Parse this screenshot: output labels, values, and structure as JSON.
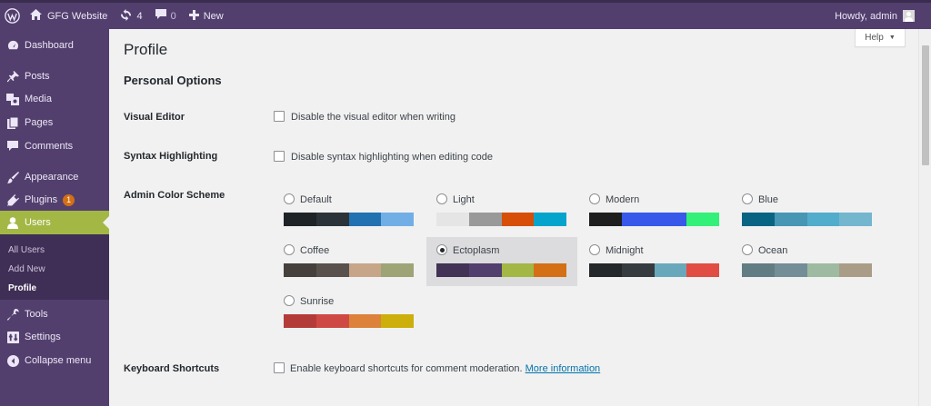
{
  "adminbar": {
    "site_name": "GFG Website",
    "updates_count": "4",
    "comments_count": "0",
    "new_label": "New",
    "howdy": "Howdy, admin"
  },
  "sidebar": {
    "items": [
      {
        "label": "Dashboard",
        "icon": "dashboard-icon"
      },
      {
        "label": "Posts",
        "icon": "pin-icon"
      },
      {
        "label": "Media",
        "icon": "media-icon"
      },
      {
        "label": "Pages",
        "icon": "pages-icon"
      },
      {
        "label": "Comments",
        "icon": "comments-icon"
      },
      {
        "label": "Appearance",
        "icon": "brush-icon"
      },
      {
        "label": "Plugins",
        "icon": "plugin-icon",
        "badge": "1"
      },
      {
        "label": "Users",
        "icon": "users-icon",
        "current": true
      },
      {
        "label": "Tools",
        "icon": "wrench-icon"
      },
      {
        "label": "Settings",
        "icon": "settings-icon"
      },
      {
        "label": "Collapse menu",
        "icon": "collapse-icon"
      }
    ],
    "submenu": [
      "All Users",
      "Add New",
      "Profile"
    ]
  },
  "help_label": "Help",
  "page_title": "Profile",
  "section_title": "Personal Options",
  "visual_editor": {
    "label": "Visual Editor",
    "option": "Disable the visual editor when writing"
  },
  "syntax_highlighting": {
    "label": "Syntax Highlighting",
    "option": "Disable syntax highlighting when editing code"
  },
  "color_scheme": {
    "label": "Admin Color Scheme",
    "selected": "Ectoplasm",
    "schemes": [
      {
        "name": "Default",
        "colors": [
          "#1d2327",
          "#2c3338",
          "#2271b1",
          "#72aee6"
        ]
      },
      {
        "name": "Light",
        "colors": [
          "#e5e5e5",
          "#999999",
          "#d64e07",
          "#04a4cc"
        ]
      },
      {
        "name": "Modern",
        "colors": [
          "#1e1e1e",
          "#3858e9",
          "#3858e9",
          "#33f078"
        ]
      },
      {
        "name": "Blue",
        "colors": [
          "#096484",
          "#4796b3",
          "#52accc",
          "#74b6ce"
        ]
      },
      {
        "name": "Coffee",
        "colors": [
          "#46403c",
          "#59524c",
          "#c7a589",
          "#9ea476"
        ]
      },
      {
        "name": "Ectoplasm",
        "colors": [
          "#413256",
          "#523f6d",
          "#a3b745",
          "#d46f15"
        ]
      },
      {
        "name": "Midnight",
        "colors": [
          "#25282b",
          "#363b3f",
          "#69a8bb",
          "#e14d43"
        ]
      },
      {
        "name": "Ocean",
        "colors": [
          "#627c83",
          "#738e96",
          "#9ebaa0",
          "#aa9d88"
        ]
      },
      {
        "name": "Sunrise",
        "colors": [
          "#b43c38",
          "#cf4944",
          "#dd823b",
          "#ccaf0b"
        ]
      }
    ]
  },
  "keyboard_shortcuts": {
    "label": "Keyboard Shortcuts",
    "option": "Enable keyboard shortcuts for comment moderation.",
    "link": "More information"
  }
}
